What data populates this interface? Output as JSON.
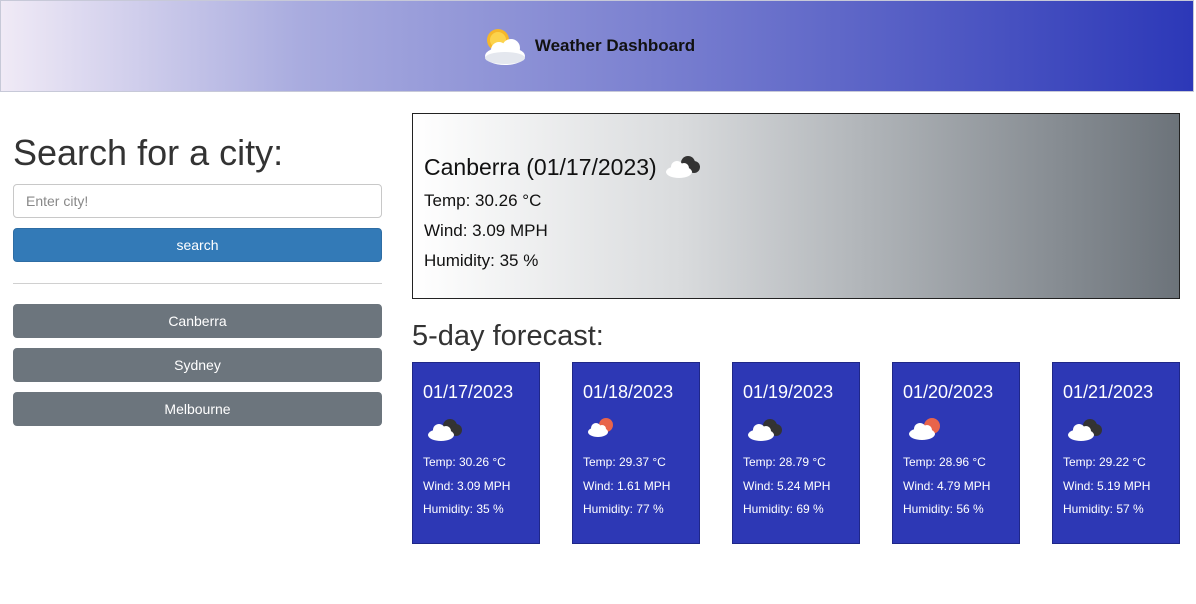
{
  "header": {
    "title": "Weather Dashboard",
    "icon": "sun-cloud-icon"
  },
  "search": {
    "heading": "Search for a city:",
    "placeholder": "Enter city!",
    "value": "",
    "button_label": "search",
    "history": [
      "Canberra",
      "Sydney",
      "Melbourne"
    ]
  },
  "current": {
    "title": "Canberra (01/17/2023)",
    "icon": "broken-clouds-icon",
    "temp": "Temp: 30.26 °C",
    "wind": "Wind: 3.09 MPH",
    "humidity": "Humidity: 35 %"
  },
  "forecast": {
    "heading": "5-day forecast:",
    "days": [
      {
        "date": "01/17/2023",
        "icon": "broken-clouds-icon",
        "temp": "Temp: 30.26 °C",
        "wind": "Wind: 3.09 MPH",
        "humidity": "Humidity: 35 %"
      },
      {
        "date": "01/18/2023",
        "icon": "few-clouds-icon",
        "temp": "Temp: 29.37 °C",
        "wind": "Wind: 1.61 MPH",
        "humidity": "Humidity: 77 %"
      },
      {
        "date": "01/19/2023",
        "icon": "broken-clouds-icon",
        "temp": "Temp: 28.79 °C",
        "wind": "Wind: 5.24 MPH",
        "humidity": "Humidity: 69 %"
      },
      {
        "date": "01/20/2023",
        "icon": "few-clouds-icon",
        "temp": "Temp: 28.96 °C",
        "wind": "Wind: 4.79 MPH",
        "humidity": "Humidity: 56 %"
      },
      {
        "date": "01/21/2023",
        "icon": "broken-clouds-icon",
        "temp": "Temp: 29.22 °C",
        "wind": "Wind: 5.19 MPH",
        "humidity": "Humidity: 57 %"
      }
    ]
  },
  "colors": {
    "header_gradient_start": "#f0eaf6",
    "header_gradient_end": "#2c38b8",
    "search_button": "#337ab7",
    "history_button": "#6c757d",
    "forecast_card": "#2d38b5"
  }
}
